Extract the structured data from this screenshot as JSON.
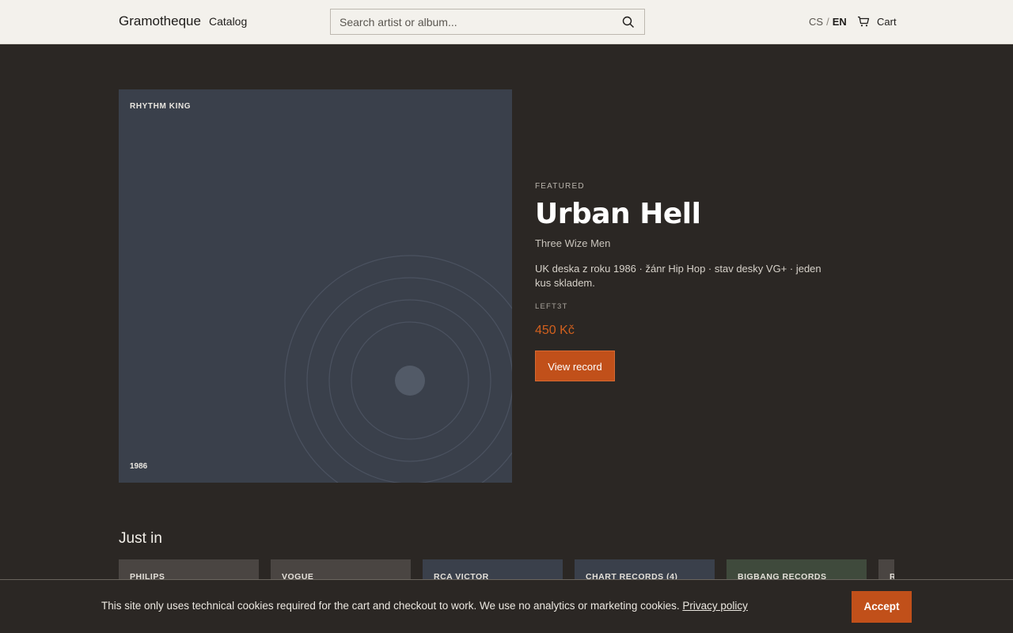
{
  "header": {
    "brand": "Gramotheque",
    "nav_catalog": "Catalog",
    "search_placeholder": "Search artist or album...",
    "lang_cs": "CS",
    "lang_sep": "/",
    "lang_en": "EN",
    "cart_label": "Cart"
  },
  "hero": {
    "cover_label": "RHYTHM KING",
    "cover_year": "1986",
    "featured": "FEATURED",
    "title": "Urban Hell",
    "artist": "Three Wize Men",
    "description": "UK deska z roku 1986 · žánr Hip Hop · stav desky VG+ · jeden kus skladem.",
    "sku": "LEFT3T",
    "price": "450 Kč",
    "button_label": "View record",
    "accent": "#c1501a"
  },
  "just_in": {
    "title": "Just in",
    "tiles": [
      {
        "label": "PHILIPS",
        "color": "#4a4542"
      },
      {
        "label": "VOGUE",
        "color": "#4a4542"
      },
      {
        "label": "RCA VICTOR",
        "color": "#3a404b"
      },
      {
        "label": "CHART RECORDS (4)",
        "color": "#3a404b"
      },
      {
        "label": "BIGBANG RECORDS",
        "color": "#3f4a3c"
      },
      {
        "label": "R",
        "color": "#4a4542"
      }
    ]
  },
  "cookie": {
    "text": "This site only uses technical cookies required for the cart and checkout to work. We use no analytics or marketing cookies.",
    "link": "Privacy policy",
    "accept": "Accept"
  }
}
